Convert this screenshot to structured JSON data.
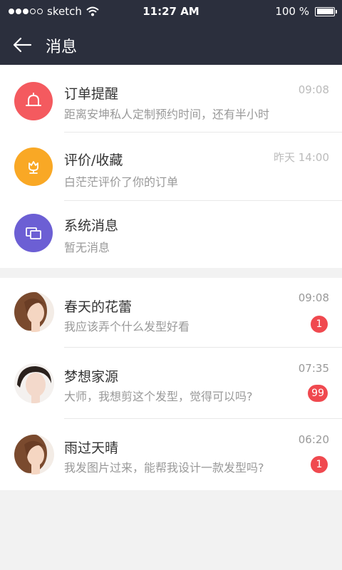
{
  "status_bar": {
    "carrier": "sketch",
    "time": "11:27 AM",
    "battery": "100 %",
    "battery_level": 1.0
  },
  "nav": {
    "title": "消息"
  },
  "system_items": [
    {
      "title": "订单提醒",
      "subtitle": "距离安坤私人定制预约时间，还有半小时",
      "time": "09:08",
      "icon": "bell-icon",
      "color": "#f45a5f"
    },
    {
      "title": "评价/收藏",
      "subtitle": "白茫茫评价了你的订单",
      "time": "昨天 14:00",
      "icon": "flower-icon",
      "color": "#f9a825"
    },
    {
      "title": "系统消息",
      "subtitle": "暂无消息",
      "time": "",
      "icon": "windows-icon",
      "color": "#6c5fd4"
    }
  ],
  "chats": [
    {
      "name": "春天的花蕾",
      "message": "我应该弄个什么发型好看",
      "time": "09:08",
      "unread": "1"
    },
    {
      "name": "梦想家源",
      "message": "大师，我想剪这个发型，觉得可以吗?",
      "time": "07:35",
      "unread": "99"
    },
    {
      "name": "雨过天晴",
      "message": "我发图片过来，能帮我设计一款发型吗?",
      "time": "06:20",
      "unread": "1"
    }
  ]
}
